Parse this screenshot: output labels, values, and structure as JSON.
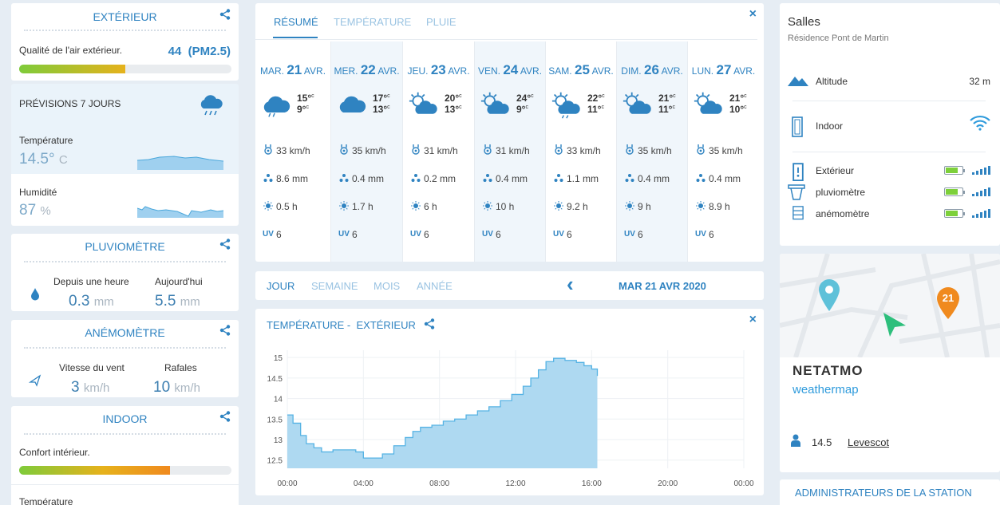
{
  "left": {
    "exterieur": {
      "title": "EXTÉRIEUR",
      "air_label": "Qualité de l'air extérieur.",
      "air_value": "44",
      "air_unit": "(PM2.5)",
      "air_bar_fraction": 0.5
    },
    "forecast": {
      "title": "PRÉVISIONS 7 JOURS",
      "temp_label": "Température",
      "temp_value": "14.5°",
      "temp_unit": "C",
      "hum_label": "Humidité",
      "hum_value": "87",
      "hum_unit": "%"
    },
    "pluvio": {
      "title": "PLUVIOMÈTRE",
      "hour_label": "Depuis une heure",
      "hour_value": "0.3",
      "today_label": "Aujourd'hui",
      "today_value": "5.5",
      "unit": "mm"
    },
    "anemo": {
      "title": "ANÉMOMÈTRE",
      "speed_label": "Vitesse du vent",
      "speed_value": "3",
      "gust_label": "Rafales",
      "gust_value": "10",
      "unit": "km/h"
    },
    "indoor": {
      "title": "INDOOR",
      "comfort_label": "Confort intérieur.",
      "comfort_bar_fraction": 0.71,
      "temp_label": "Température"
    }
  },
  "forecast_panel": {
    "tabs": [
      "RÉSUMÉ",
      "TEMPÉRATURE",
      "PLUIE"
    ],
    "days": [
      {
        "dow": "MAR.",
        "day": "21",
        "month": "AVR.",
        "icon": "rain-cloud-icon",
        "max": "15°",
        "min": "9°",
        "wind": "33 km/h",
        "rain": "8.6 mm",
        "sun": "0.5 h",
        "uv": "6"
      },
      {
        "dow": "MER.",
        "day": "22",
        "month": "AVR.",
        "icon": "cloud-icon",
        "max": "17°",
        "min": "13°",
        "wind": "35 km/h",
        "rain": "0.4 mm",
        "sun": "1.7 h",
        "uv": "6"
      },
      {
        "dow": "JEU.",
        "day": "23",
        "month": "AVR.",
        "icon": "sun-cloud-icon",
        "max": "20°",
        "min": "13°",
        "wind": "31 km/h",
        "rain": "0.2 mm",
        "sun": "6 h",
        "uv": "6"
      },
      {
        "dow": "VEN.",
        "day": "24",
        "month": "AVR.",
        "icon": "sun-cloud-icon",
        "max": "24°",
        "min": "9°",
        "wind": "31 km/h",
        "rain": "0.4 mm",
        "sun": "10 h",
        "uv": "6"
      },
      {
        "dow": "SAM.",
        "day": "25",
        "month": "AVR.",
        "icon": "sun-rain-icon",
        "max": "22°",
        "min": "11°",
        "wind": "33 km/h",
        "rain": "1.1 mm",
        "sun": "9.2 h",
        "uv": "6"
      },
      {
        "dow": "DIM.",
        "day": "26",
        "month": "AVR.",
        "icon": "sun-cloud-icon",
        "max": "21°",
        "min": "11°",
        "wind": "35 km/h",
        "rain": "0.4 mm",
        "sun": "9 h",
        "uv": "6"
      },
      {
        "dow": "LUN.",
        "day": "27",
        "month": "AVR.",
        "icon": "sun-cloud-icon",
        "max": "21°",
        "min": "10°",
        "wind": "35 km/h",
        "rain": "0.4 mm",
        "sun": "8.9 h",
        "uv": "6"
      }
    ],
    "unit_c": "c",
    "uv_label": "UV",
    "close_icon": "×"
  },
  "period": {
    "tabs": [
      "JOUR",
      "SEMAINE",
      "MOIS",
      "ANNÉE"
    ],
    "date": "MAR 21 AVR 2020",
    "prev_icon": "‹"
  },
  "chart_panel": {
    "title_a": "TEMPÉRATURE -",
    "title_b": "EXTÉRIEUR",
    "close_icon": "×"
  },
  "chart_data": {
    "type": "area",
    "title": "TEMPÉRATURE - EXTÉRIEUR",
    "xlabel": "",
    "ylabel": "",
    "x_ticks": [
      "00:00",
      "04:00",
      "08:00",
      "12:00",
      "16:00",
      "20:00",
      "00:00"
    ],
    "xlim": [
      0,
      24
    ],
    "y_ticks": [
      "15",
      "14.5",
      "14",
      "13.5",
      "13",
      "12.5"
    ],
    "ylim": [
      12.3,
      15.1
    ],
    "grid": true,
    "color": "#aed9f1",
    "line_color": "#56b3e4",
    "x": [
      0,
      0.3,
      0.7,
      1,
      1.4,
      1.8,
      2.4,
      3,
      3.6,
      4,
      4.6,
      5,
      5.6,
      6.2,
      6.6,
      7,
      7.6,
      8.2,
      8.8,
      9.4,
      10,
      10.6,
      11.2,
      11.8,
      12.4,
      12.8,
      13.2,
      13.6,
      14,
      14.6,
      15.2,
      15.6,
      16,
      16.3
    ],
    "y": [
      13.6,
      13.4,
      13.1,
      12.9,
      12.8,
      12.7,
      12.75,
      12.75,
      12.7,
      12.55,
      12.55,
      12.65,
      12.85,
      13.05,
      13.2,
      13.3,
      13.35,
      13.45,
      13.5,
      13.6,
      13.7,
      13.8,
      13.95,
      14.1,
      14.3,
      14.5,
      14.7,
      14.9,
      14.98,
      14.93,
      14.88,
      14.8,
      14.72,
      14.55
    ]
  },
  "station": {
    "name": "Salles",
    "location": "Résidence Pont de Martin",
    "altitude_label": "Altitude",
    "altitude_value": "32 m",
    "indoor_label": "Indoor",
    "modules": [
      {
        "name": "Extérieur"
      },
      {
        "name": "pluviomètre"
      },
      {
        "name": "anémomètre"
      }
    ]
  },
  "map": {
    "brand": "NETATMO",
    "subtitle": "weathermap",
    "pin_number": "21",
    "user_value": "14.5",
    "user_name": "Levescot"
  },
  "admins": {
    "title": "ADMINISTRATEURS DE LA STATION"
  }
}
